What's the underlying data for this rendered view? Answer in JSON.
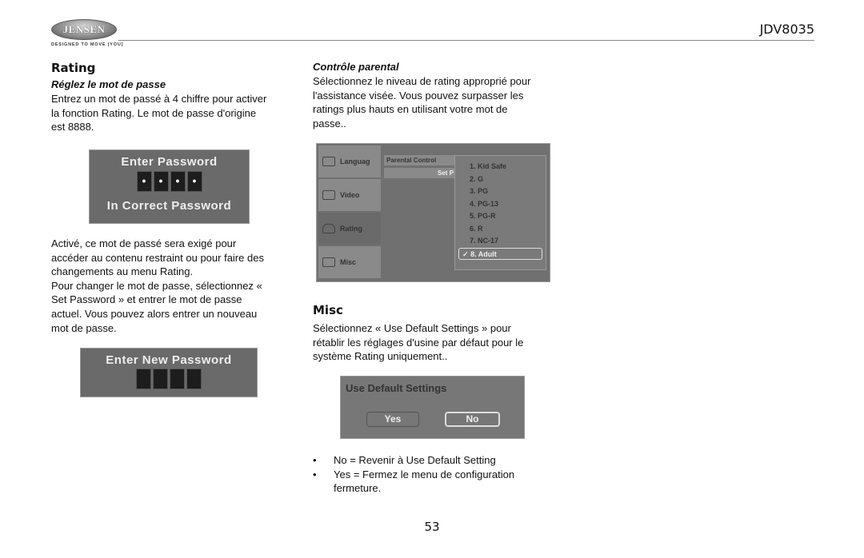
{
  "header": {
    "logo": "JENSEN",
    "tagline": "DESIGNED TO MOVE [YOU]",
    "model": "JDV8035"
  },
  "left": {
    "title": "Rating",
    "subtitle": "Réglez le mot de passe",
    "intro": [
      "Entrez un mot de passé à 4 chiffre pour activer",
      "la fonction Rating. Le mot de passe d'origine",
      "est 8888."
    ],
    "osd1": {
      "title": "Enter Password",
      "digits": [
        "•",
        "•",
        "•",
        "•"
      ],
      "message": "In Correct Password"
    },
    "body": [
      "Activé, ce mot de passé sera exigé pour",
      "accéder au contenu restraint ou pour faire des",
      "changements au menu Rating.",
      "Pour changer le mot de passe, sélectionnez «",
      "Set Password » et entrer le mot de passe",
      "actuel. Vous pouvez alors entrer un nouveau",
      "mot de passe."
    ],
    "osd2": {
      "title": "Enter New Password"
    }
  },
  "right": {
    "subtitle": "Contrôle parental",
    "intro": [
      "Sélectionnez le niveau de rating approprié pour",
      "l'assistance visée. Vous pouvez surpasser les",
      "ratings plus hauts en utilisant votre mot de",
      "passe.."
    ],
    "menu": {
      "tabs": [
        "Languag",
        "Video",
        "Rating",
        "Misc"
      ],
      "header": "Parental Control",
      "row": "Set P",
      "options": [
        "1. Kid Safe",
        "2. G",
        "3. PG",
        "4. PG-13",
        "5. PG-R",
        "6. R",
        "7. NC-17",
        "8. Adult"
      ],
      "selected": "8. Adult",
      "check": "✓"
    },
    "misc_title": "Misc",
    "misc_text": [
      "Sélectionnez « Use Default Settings » pour",
      "rétablir les réglages d'usine par défaut pour le",
      "système Rating uniquement.."
    ],
    "dialog": {
      "title": "Use Default Settings",
      "yes": "Yes",
      "no": "No"
    },
    "bullets": [
      [
        "No = Revenir à Use Default Setting"
      ],
      [
        "Yes = Fermez le menu de configuration",
        "fermeture."
      ]
    ]
  },
  "footer": {
    "page": "53"
  }
}
